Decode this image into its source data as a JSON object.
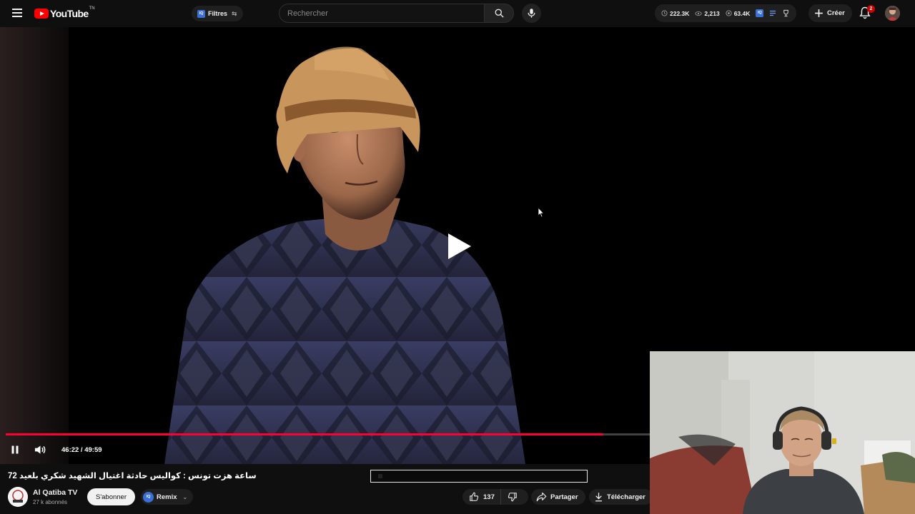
{
  "header": {
    "logo_text": "YouTube",
    "logo_tm": "TN",
    "filters_label": "Filtres",
    "search_placeholder": "Rechercher",
    "stats": {
      "time": "222.3K",
      "views": "2,213",
      "eye": "63.4K"
    },
    "create_label": "Créer",
    "notification_count": "2"
  },
  "player": {
    "current_time": "46:22",
    "duration": "49:59",
    "time_display": "46:22 / 49:59",
    "progress": 0.9274,
    "state": "paused-overlay",
    "colors": {
      "progress": "#ff0033",
      "brand": "#ff0000"
    }
  },
  "video": {
    "title": "ساعة هزت تونس : كواليس حادثة اغتيال الشهيد شكري بلعيد 72",
    "channel_name": "Al Qatiba TV",
    "subscribers": "27 k abonnés",
    "subscribe_label": "S'abonner",
    "remix_label": "Remix",
    "likes": "137",
    "share_label": "Partager",
    "download_label": "Télécharger"
  },
  "icons": {
    "iq_badge": "IQ"
  }
}
